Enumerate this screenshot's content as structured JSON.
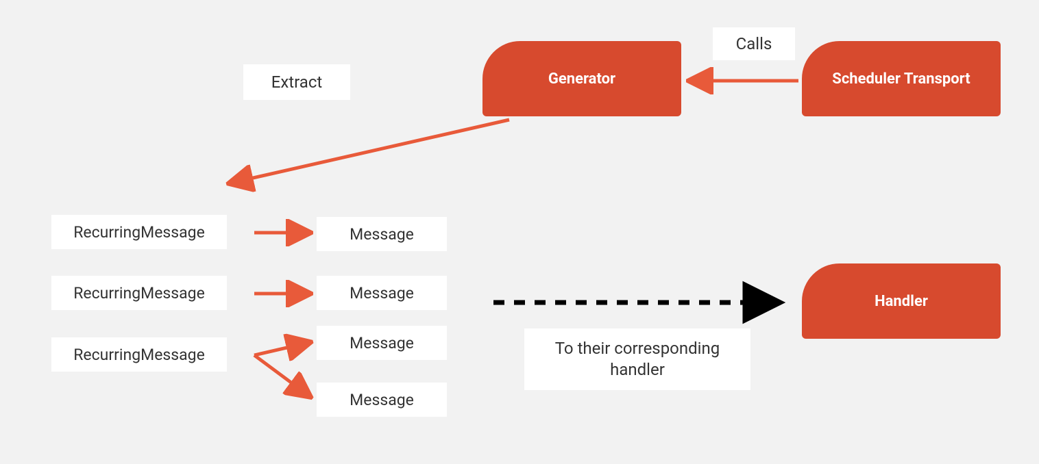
{
  "colors": {
    "accent": "#d74a2e",
    "bg": "#f2f2f2",
    "text_dark": "#333333",
    "white": "#ffffff"
  },
  "nodes": {
    "generator": {
      "label": "Generator"
    },
    "scheduler_transport": {
      "label": "Scheduler Transport"
    },
    "handler": {
      "label": "Handler"
    }
  },
  "labels": {
    "calls": "Calls",
    "extract": "Extract",
    "to_corresponding_handler": "To their corresponding handler"
  },
  "recurring": {
    "items": [
      {
        "label": "RecurringMessage"
      },
      {
        "label": "RecurringMessage"
      },
      {
        "label": "RecurringMessage"
      }
    ]
  },
  "messages": {
    "items": [
      {
        "label": "Message"
      },
      {
        "label": "Message"
      },
      {
        "label": "Message"
      },
      {
        "label": "Message"
      }
    ]
  },
  "edges": [
    {
      "from": "scheduler_transport",
      "to": "generator",
      "label": "Calls",
      "style": "solid-red"
    },
    {
      "from": "generator",
      "to": "recurring_group",
      "label": "Extract",
      "style": "solid-red"
    },
    {
      "from": "recurring[0]",
      "to": "messages[0]",
      "style": "solid-red"
    },
    {
      "from": "recurring[1]",
      "to": "messages[1]",
      "style": "solid-red"
    },
    {
      "from": "recurring[2]",
      "to": "messages[2]",
      "style": "solid-red"
    },
    {
      "from": "recurring[2]",
      "to": "messages[3]",
      "style": "solid-red"
    },
    {
      "from": "messages_group",
      "to": "handler",
      "label": "To their corresponding handler",
      "style": "dashed-black"
    }
  ]
}
